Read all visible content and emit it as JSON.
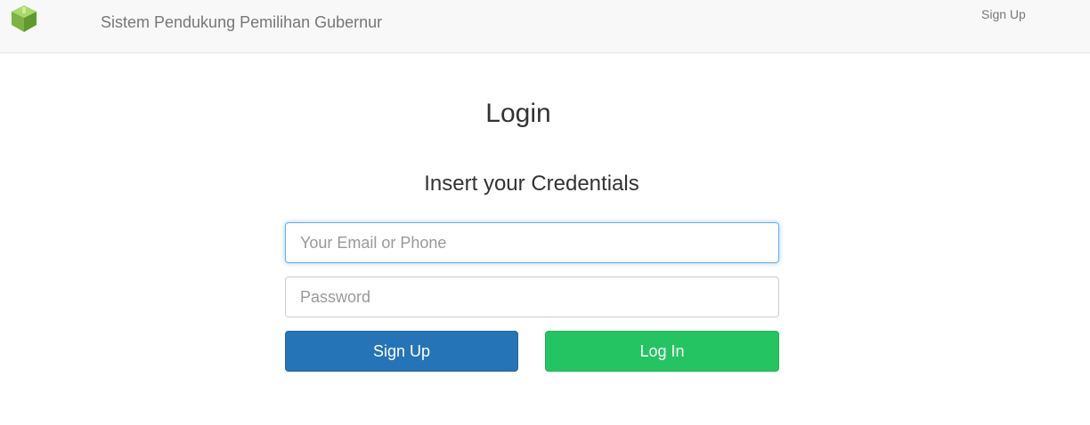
{
  "navbar": {
    "brand": "Sistem Pendukung Pemilihan Gubernur",
    "signup_link": "Sign Up",
    "logo_icon": "green-cube-logo-icon"
  },
  "main": {
    "title": "Login",
    "subtitle": "Insert your Credentials",
    "email_placeholder": "Your Email or Phone",
    "password_placeholder": "Password",
    "signup_button": "Sign Up",
    "login_button": "Log In"
  },
  "colors": {
    "signup_button": "#2574b8",
    "login_button": "#25c462",
    "focus_border": "#66afe9"
  }
}
